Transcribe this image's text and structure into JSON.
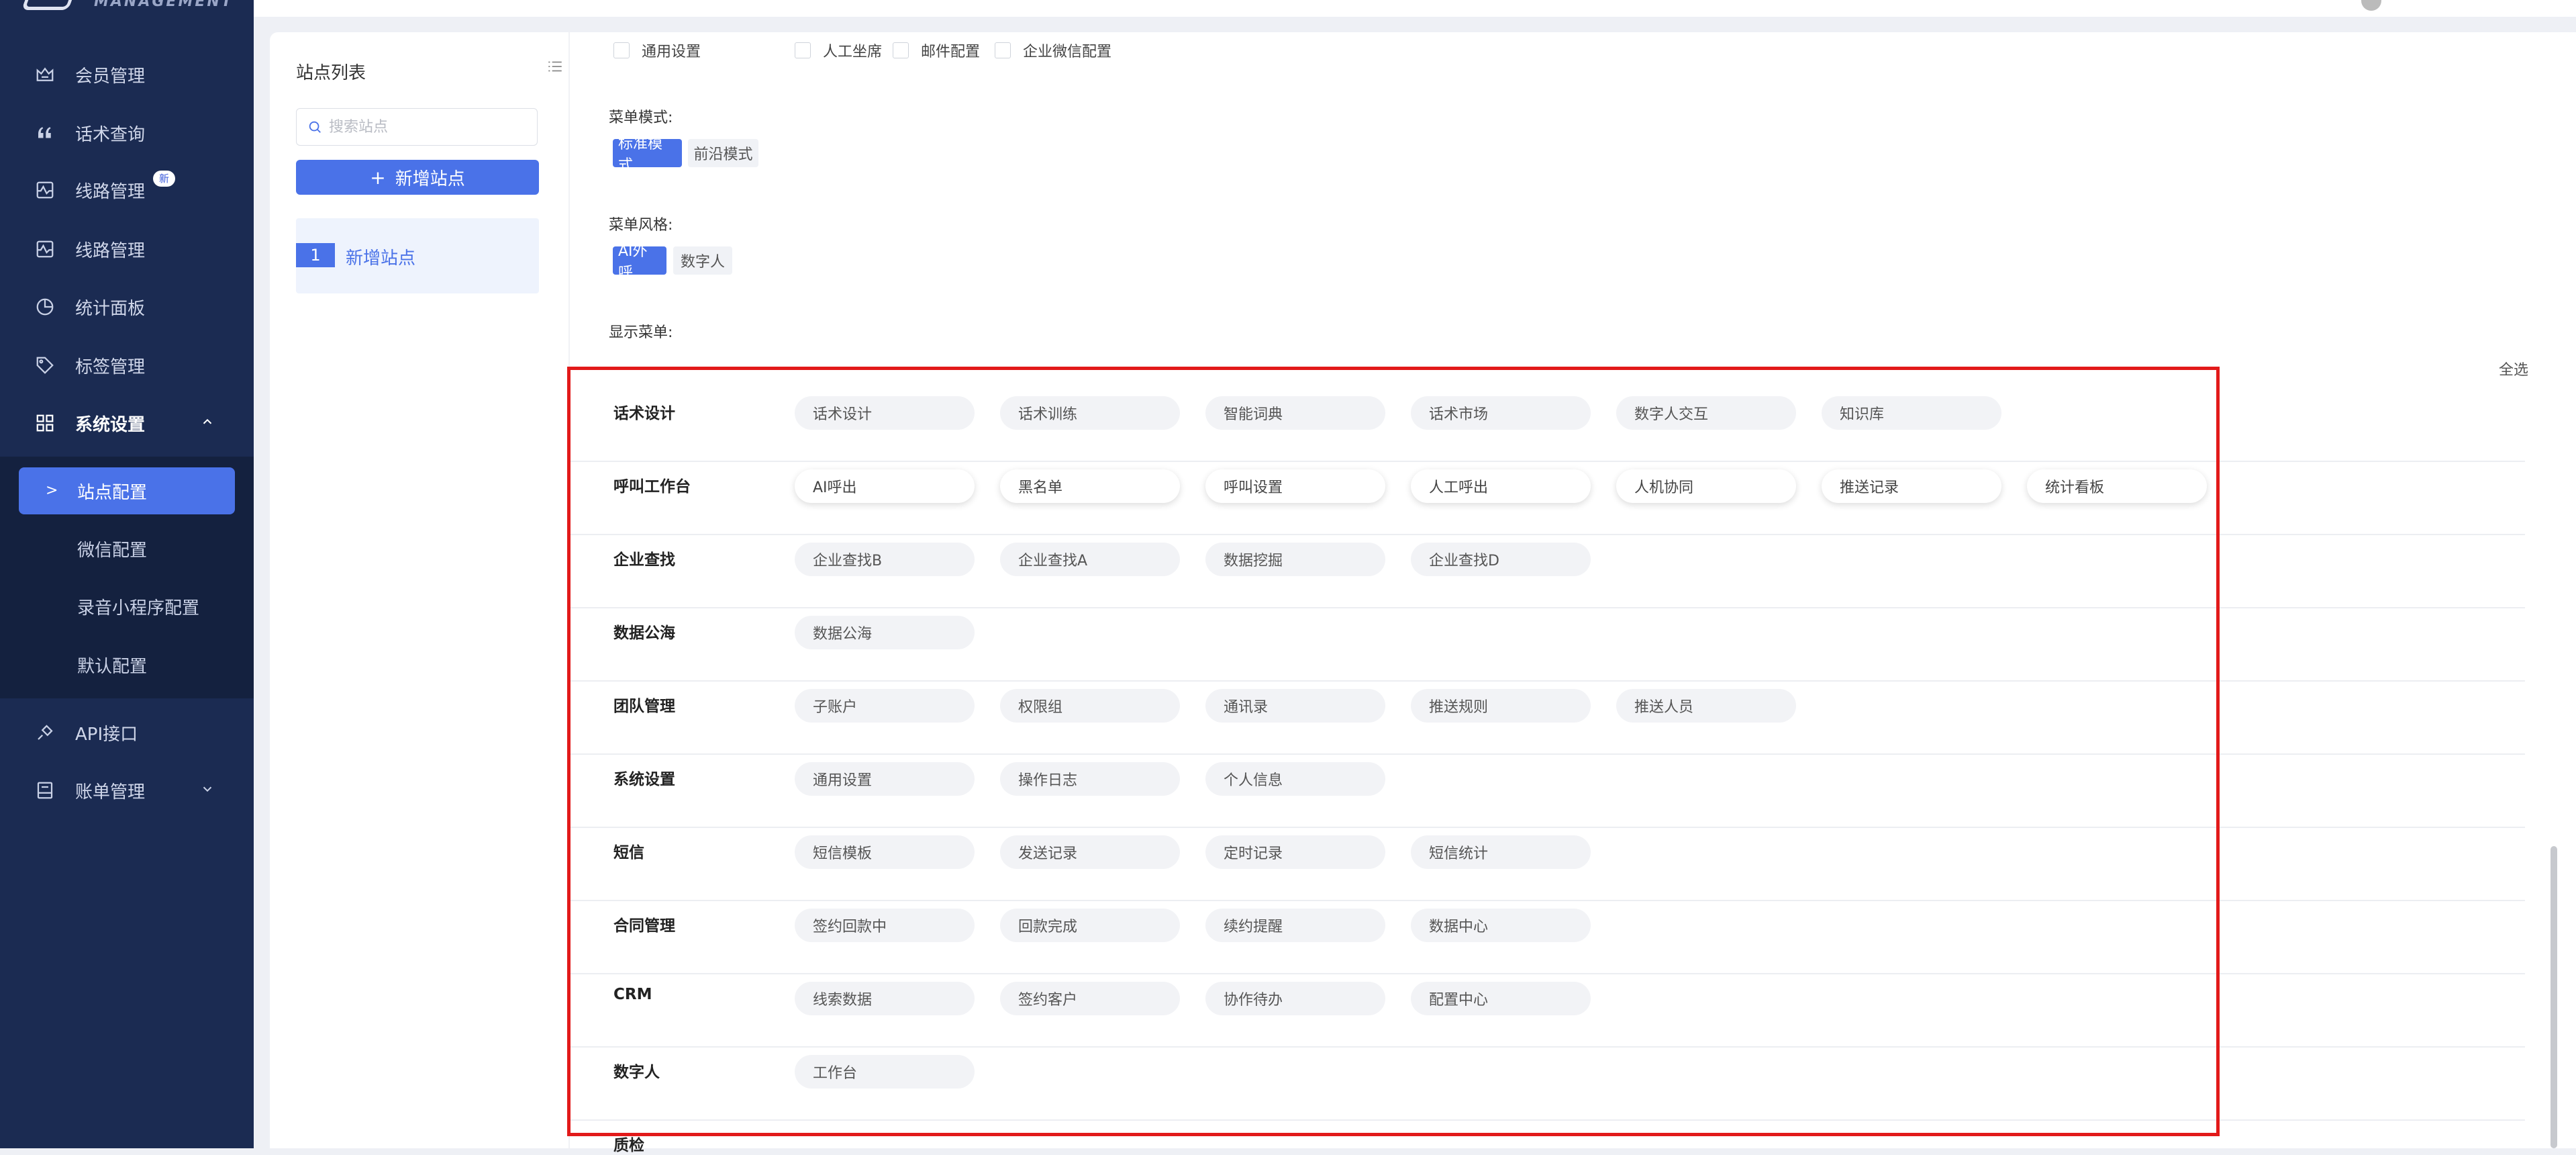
{
  "brand": {
    "logo_text": "MANAGEMENT"
  },
  "sidebar": {
    "items": [
      {
        "label": "会员管理",
        "icon": "crown-icon"
      },
      {
        "label": "话术查询",
        "icon": "quote-icon"
      },
      {
        "label": "线路管理",
        "icon": "line-icon",
        "badge": "新"
      },
      {
        "label": "线路管理",
        "icon": "line-icon"
      },
      {
        "label": "统计面板",
        "icon": "pie-chart-icon"
      },
      {
        "label": "标签管理",
        "icon": "tag-icon"
      },
      {
        "label": "系统设置",
        "icon": "grid-icon"
      }
    ],
    "sub_items": [
      "站点配置",
      "微信配置",
      "录音小程序配置",
      "默认配置"
    ],
    "bottom_items": [
      {
        "label": "API接口",
        "icon": "plug-icon"
      },
      {
        "label": "账单管理",
        "icon": "bill-icon"
      }
    ]
  },
  "station_panel": {
    "title": "站点列表",
    "search_placeholder": "搜索站点",
    "add_button": "新增站点",
    "stations": [
      {
        "num": "1",
        "name": "新增站点"
      }
    ]
  },
  "settings": {
    "feature_checks": [
      "通用设置",
      "人工坐席",
      "邮件配置",
      "企业微信配置"
    ],
    "menu_mode_label": "菜单模式:",
    "menu_modes": [
      "标准模式",
      "前沿模式"
    ],
    "menu_style_label": "菜单风格:",
    "menu_styles": [
      "AI外呼",
      "数字人"
    ],
    "show_menu_label": "显示菜单:",
    "select_all": "全选"
  },
  "menu_groups": [
    {
      "name": "话术设计",
      "items": [
        "话术设计",
        "话术训练",
        "智能词典",
        "话术市场",
        "数字人交互",
        "知识库"
      ]
    },
    {
      "name": "呼叫工作台",
      "items": [
        "AI呼出",
        "黑名单",
        "呼叫设置",
        "人工呼出",
        "人机协同",
        "推送记录",
        "统计看板"
      ]
    },
    {
      "name": "企业查找",
      "items": [
        "企业查找B",
        "企业查找A",
        "数据挖掘",
        "企业查找D"
      ]
    },
    {
      "name": "数据公海",
      "items": [
        "数据公海"
      ]
    },
    {
      "name": "团队管理",
      "items": [
        "子账户",
        "权限组",
        "通讯录",
        "推送规则",
        "推送人员"
      ]
    },
    {
      "name": "系统设置",
      "items": [
        "通用设置",
        "操作日志",
        "个人信息"
      ]
    },
    {
      "name": "短信",
      "items": [
        "短信模板",
        "发送记录",
        "定时记录",
        "短信统计"
      ]
    },
    {
      "name": "合同管理",
      "items": [
        "签约回款中",
        "回款完成",
        "续约提醒",
        "数据中心"
      ]
    },
    {
      "name": "CRM",
      "items": [
        "线索数据",
        "签约客户",
        "协作待办",
        "配置中心"
      ]
    },
    {
      "name": "数字人",
      "items": [
        "工作台"
      ]
    },
    {
      "name": "质检",
      "items": []
    }
  ]
}
